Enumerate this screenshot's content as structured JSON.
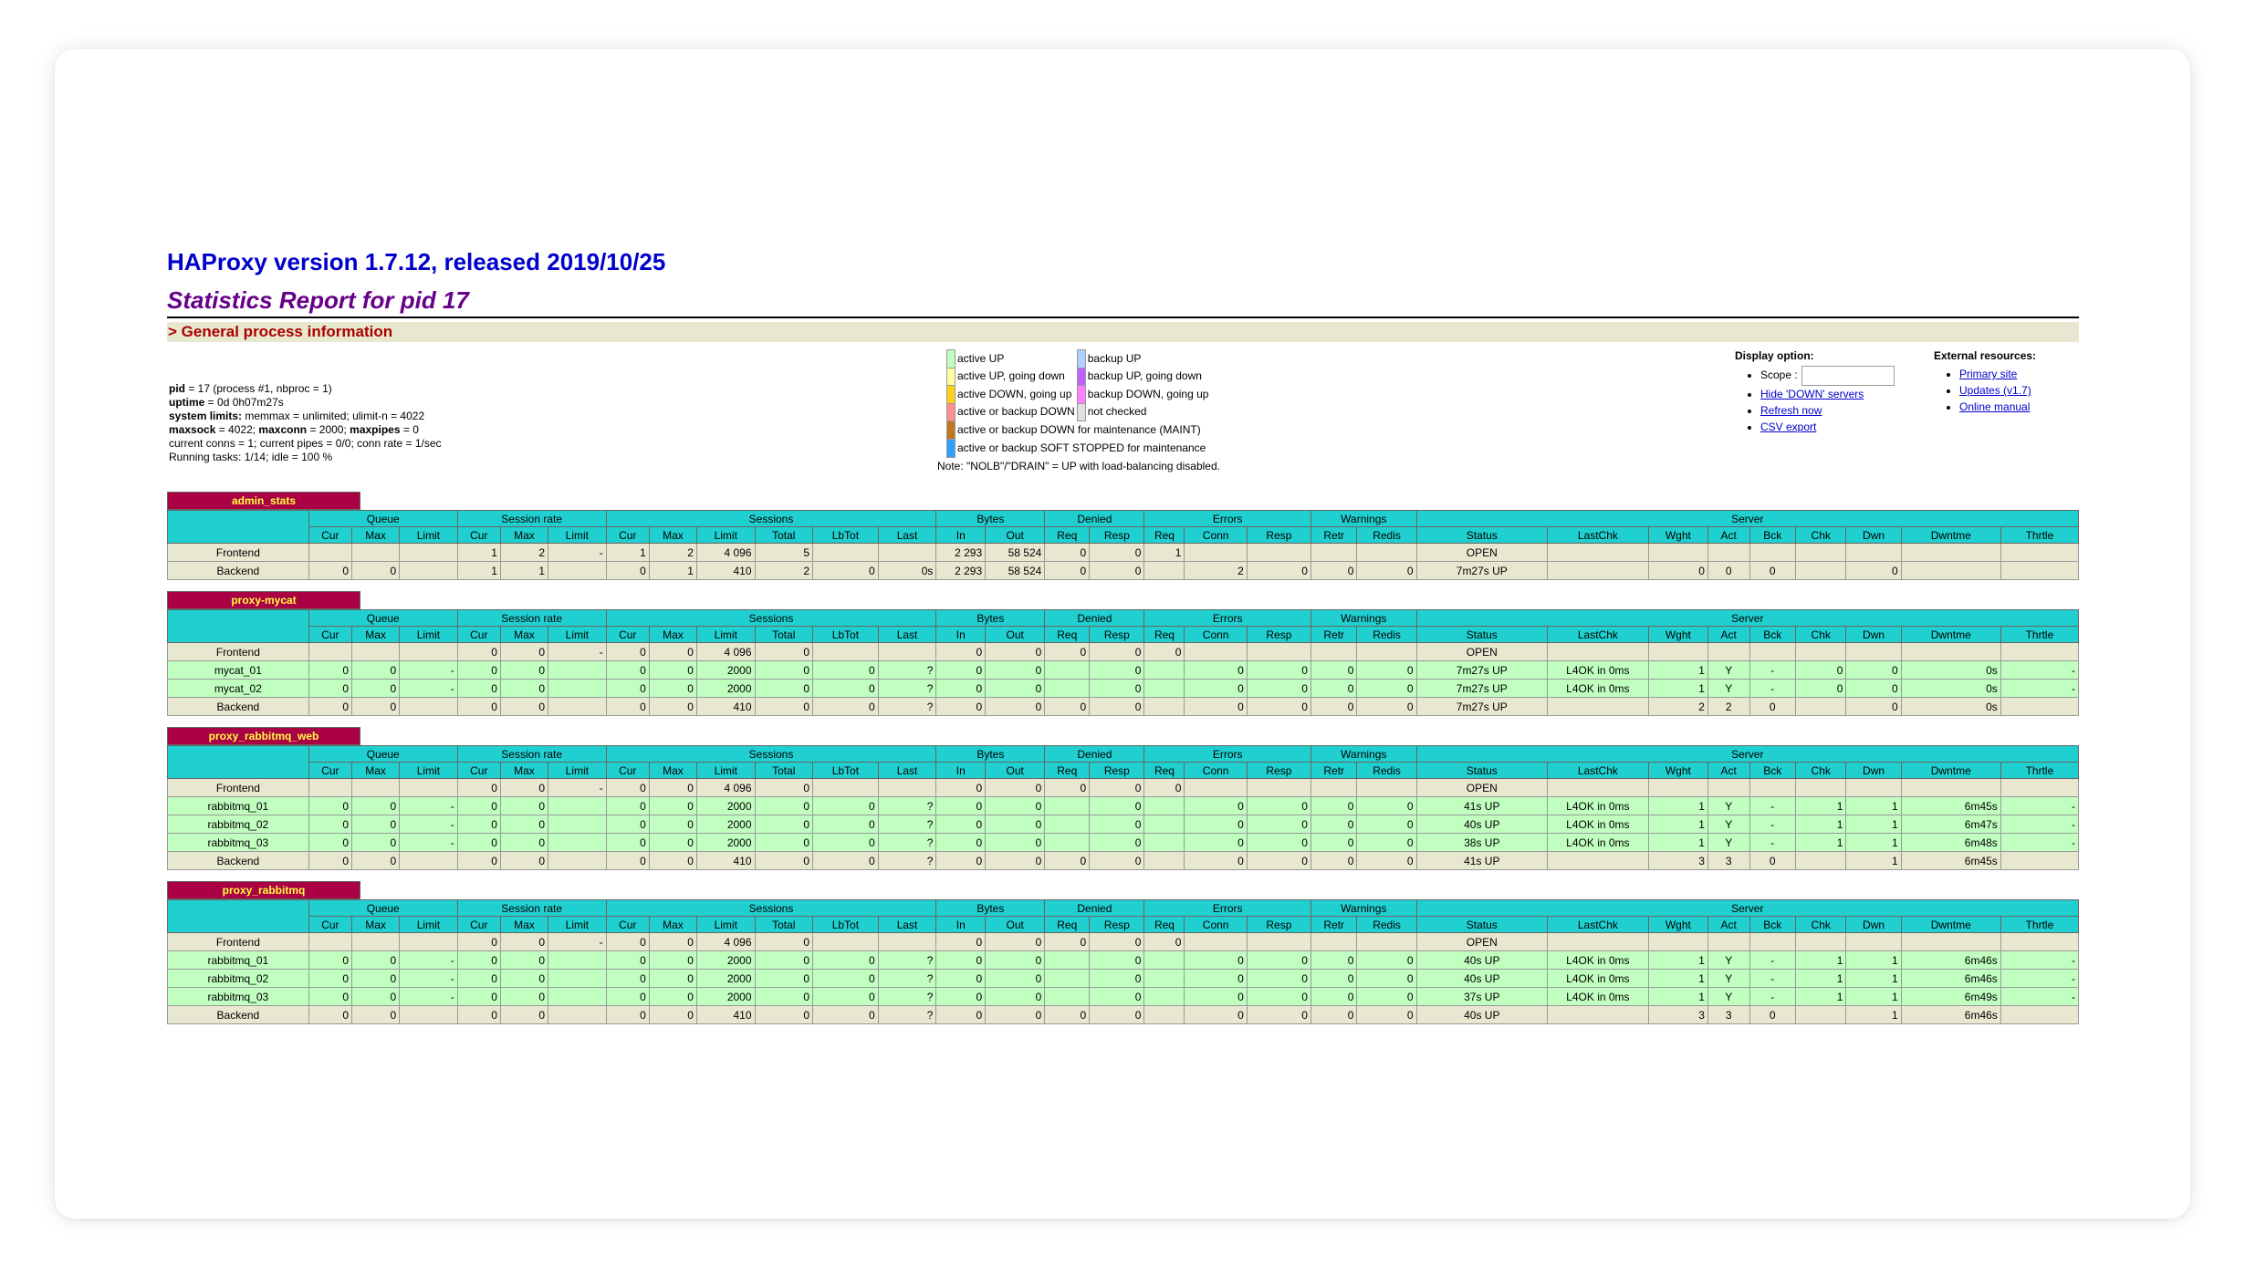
{
  "header": {
    "title": "HAProxy version 1.7.12, released 2019/10/25",
    "subtitle": "Statistics Report for pid 17",
    "section": "> General process information"
  },
  "process": {
    "pid_label": "pid",
    "pid_text": " = 17 (process #1, nbproc = 1)",
    "uptime_label": "uptime",
    "uptime_text": " = 0d 0h07m27s",
    "syslimits_label": "system limits:",
    "syslimits_text": " memmax = unlimited; ulimit-n = 4022",
    "maxsock_label": "maxsock",
    "maxsock_text": " = 4022; ",
    "maxconn_label": "maxconn",
    "maxconn_text": " = 2000; ",
    "maxpipes_label": "maxpipes",
    "maxpipes_text": " = 0",
    "current_text": "current conns = 1; current pipes = 0/0; conn rate = 1/sec",
    "tasks_text": "Running tasks: 1/14; idle = 100 %"
  },
  "legend": {
    "items_left": [
      {
        "color": "#c0ffc0",
        "label": "active UP"
      },
      {
        "color": "#ffffa0",
        "label": "active UP, going down"
      },
      {
        "color": "#ffd020",
        "label": "active DOWN, going up"
      },
      {
        "color": "#ff9090",
        "label": "active or backup DOWN"
      },
      {
        "color": "#c07820",
        "label": "active or backup DOWN for maintenance (MAINT)"
      },
      {
        "color": "#30a0ff",
        "label": "active or backup SOFT STOPPED for maintenance"
      }
    ],
    "items_right": [
      {
        "color": "#b0d0ff",
        "label": "backup UP"
      },
      {
        "color": "#c060ff",
        "label": "backup UP, going down"
      },
      {
        "color": "#ff80ff",
        "label": "backup DOWN, going up"
      },
      {
        "color": "#e0e0e0",
        "label": "not checked"
      }
    ],
    "note": "Note: \"NOLB\"/\"DRAIN\" = UP with load-balancing disabled."
  },
  "display_options": {
    "label": "Display option:",
    "scope_label": "Scope :",
    "scope_value": "",
    "links": [
      "Hide 'DOWN' servers",
      "Refresh now",
      "CSV export"
    ]
  },
  "external_resources": {
    "label": "External resources:",
    "links": [
      "Primary site",
      "Updates (v1.7)",
      "Online manual"
    ]
  },
  "columns": {
    "groups": [
      "Queue",
      "Session rate",
      "Sessions",
      "Bytes",
      "Denied",
      "Errors",
      "Warnings",
      "Server"
    ],
    "sub": [
      "Cur",
      "Max",
      "Limit",
      "Cur",
      "Max",
      "Limit",
      "Cur",
      "Max",
      "Limit",
      "Total",
      "LbTot",
      "Last",
      "In",
      "Out",
      "Req",
      "Resp",
      "Req",
      "Conn",
      "Resp",
      "Retr",
      "Redis",
      "Status",
      "LastChk",
      "Wght",
      "Act",
      "Bck",
      "Chk",
      "Dwn",
      "Dwntme",
      "Thrtle"
    ]
  },
  "proxies": [
    {
      "name": "admin_stats",
      "rows": [
        {
          "type": "fe",
          "cells": [
            "Frontend",
            "",
            "",
            "",
            "1",
            "2",
            "-",
            "1",
            "2",
            "4 096",
            "5",
            "",
            "",
            "2 293",
            "58 524",
            "0",
            "0",
            "1",
            "",
            "",
            "",
            "",
            "OPEN",
            "",
            "",
            "",
            "",
            "",
            "",
            "",
            ""
          ]
        },
        {
          "type": "be",
          "cells": [
            "Backend",
            "0",
            "0",
            "",
            "1",
            "1",
            "",
            "0",
            "1",
            "410",
            "2",
            "0",
            "0s",
            "2 293",
            "58 524",
            "0",
            "0",
            "",
            "2",
            "0",
            "0",
            "0",
            "7m27s UP",
            "",
            "0",
            "0",
            "0",
            "",
            "0",
            "",
            ""
          ]
        }
      ]
    },
    {
      "name": "proxy-mycat",
      "rows": [
        {
          "type": "fe",
          "cells": [
            "Frontend",
            "",
            "",
            "",
            "0",
            "0",
            "-",
            "0",
            "0",
            "4 096",
            "0",
            "",
            "",
            "0",
            "0",
            "0",
            "0",
            "0",
            "",
            "",
            "",
            "",
            "OPEN",
            "",
            "",
            "",
            "",
            "",
            "",
            "",
            ""
          ]
        },
        {
          "type": "up",
          "cells": [
            "mycat_01",
            "0",
            "0",
            "-",
            "0",
            "0",
            "",
            "0",
            "0",
            "2000",
            "0",
            "0",
            "?",
            "0",
            "0",
            "",
            "0",
            "",
            "0",
            "0",
            "0",
            "0",
            "7m27s UP",
            "L4OK in 0ms",
            "1",
            "Y",
            "-",
            "0",
            "0",
            "0s",
            "-"
          ]
        },
        {
          "type": "up",
          "cells": [
            "mycat_02",
            "0",
            "0",
            "-",
            "0",
            "0",
            "",
            "0",
            "0",
            "2000",
            "0",
            "0",
            "?",
            "0",
            "0",
            "",
            "0",
            "",
            "0",
            "0",
            "0",
            "0",
            "7m27s UP",
            "L4OK in 0ms",
            "1",
            "Y",
            "-",
            "0",
            "0",
            "0s",
            "-"
          ]
        },
        {
          "type": "be",
          "cells": [
            "Backend",
            "0",
            "0",
            "",
            "0",
            "0",
            "",
            "0",
            "0",
            "410",
            "0",
            "0",
            "?",
            "0",
            "0",
            "0",
            "0",
            "",
            "0",
            "0",
            "0",
            "0",
            "7m27s UP",
            "",
            "2",
            "2",
            "0",
            "",
            "0",
            "0s",
            ""
          ]
        }
      ]
    },
    {
      "name": "proxy_rabbitmq_web",
      "rows": [
        {
          "type": "fe",
          "cells": [
            "Frontend",
            "",
            "",
            "",
            "0",
            "0",
            "-",
            "0",
            "0",
            "4 096",
            "0",
            "",
            "",
            "0",
            "0",
            "0",
            "0",
            "0",
            "",
            "",
            "",
            "",
            "OPEN",
            "",
            "",
            "",
            "",
            "",
            "",
            "",
            ""
          ]
        },
        {
          "type": "up",
          "cells": [
            "rabbitmq_01",
            "0",
            "0",
            "-",
            "0",
            "0",
            "",
            "0",
            "0",
            "2000",
            "0",
            "0",
            "?",
            "0",
            "0",
            "",
            "0",
            "",
            "0",
            "0",
            "0",
            "0",
            "41s UP",
            "L4OK in 0ms",
            "1",
            "Y",
            "-",
            "1",
            "1",
            "6m45s",
            "-"
          ]
        },
        {
          "type": "up",
          "cells": [
            "rabbitmq_02",
            "0",
            "0",
            "-",
            "0",
            "0",
            "",
            "0",
            "0",
            "2000",
            "0",
            "0",
            "?",
            "0",
            "0",
            "",
            "0",
            "",
            "0",
            "0",
            "0",
            "0",
            "40s UP",
            "L4OK in 0ms",
            "1",
            "Y",
            "-",
            "1",
            "1",
            "6m47s",
            "-"
          ]
        },
        {
          "type": "up",
          "cells": [
            "rabbitmq_03",
            "0",
            "0",
            "-",
            "0",
            "0",
            "",
            "0",
            "0",
            "2000",
            "0",
            "0",
            "?",
            "0",
            "0",
            "",
            "0",
            "",
            "0",
            "0",
            "0",
            "0",
            "38s UP",
            "L4OK in 0ms",
            "1",
            "Y",
            "-",
            "1",
            "1",
            "6m48s",
            "-"
          ]
        },
        {
          "type": "be",
          "cells": [
            "Backend",
            "0",
            "0",
            "",
            "0",
            "0",
            "",
            "0",
            "0",
            "410",
            "0",
            "0",
            "?",
            "0",
            "0",
            "0",
            "0",
            "",
            "0",
            "0",
            "0",
            "0",
            "41s UP",
            "",
            "3",
            "3",
            "0",
            "",
            "1",
            "6m45s",
            ""
          ]
        }
      ]
    },
    {
      "name": "proxy_rabbitmq",
      "rows": [
        {
          "type": "fe",
          "cells": [
            "Frontend",
            "",
            "",
            "",
            "0",
            "0",
            "-",
            "0",
            "0",
            "4 096",
            "0",
            "",
            "",
            "0",
            "0",
            "0",
            "0",
            "0",
            "",
            "",
            "",
            "",
            "OPEN",
            "",
            "",
            "",
            "",
            "",
            "",
            "",
            ""
          ]
        },
        {
          "type": "up",
          "cells": [
            "rabbitmq_01",
            "0",
            "0",
            "-",
            "0",
            "0",
            "",
            "0",
            "0",
            "2000",
            "0",
            "0",
            "?",
            "0",
            "0",
            "",
            "0",
            "",
            "0",
            "0",
            "0",
            "0",
            "40s UP",
            "L4OK in 0ms",
            "1",
            "Y",
            "-",
            "1",
            "1",
            "6m46s",
            "-"
          ]
        },
        {
          "type": "up",
          "cells": [
            "rabbitmq_02",
            "0",
            "0",
            "-",
            "0",
            "0",
            "",
            "0",
            "0",
            "2000",
            "0",
            "0",
            "?",
            "0",
            "0",
            "",
            "0",
            "",
            "0",
            "0",
            "0",
            "0",
            "40s UP",
            "L4OK in 0ms",
            "1",
            "Y",
            "-",
            "1",
            "1",
            "6m46s",
            "-"
          ]
        },
        {
          "type": "up",
          "cells": [
            "rabbitmq_03",
            "0",
            "0",
            "-",
            "0",
            "0",
            "",
            "0",
            "0",
            "2000",
            "0",
            "0",
            "?",
            "0",
            "0",
            "",
            "0",
            "",
            "0",
            "0",
            "0",
            "0",
            "37s UP",
            "L4OK in 0ms",
            "1",
            "Y",
            "-",
            "1",
            "1",
            "6m49s",
            "-"
          ]
        },
        {
          "type": "be",
          "cells": [
            "Backend",
            "0",
            "0",
            "",
            "0",
            "0",
            "",
            "0",
            "0",
            "410",
            "0",
            "0",
            "?",
            "0",
            "0",
            "0",
            "0",
            "",
            "0",
            "0",
            "0",
            "0",
            "40s UP",
            "",
            "3",
            "3",
            "0",
            "",
            "1",
            "6m46s",
            ""
          ]
        }
      ]
    }
  ]
}
